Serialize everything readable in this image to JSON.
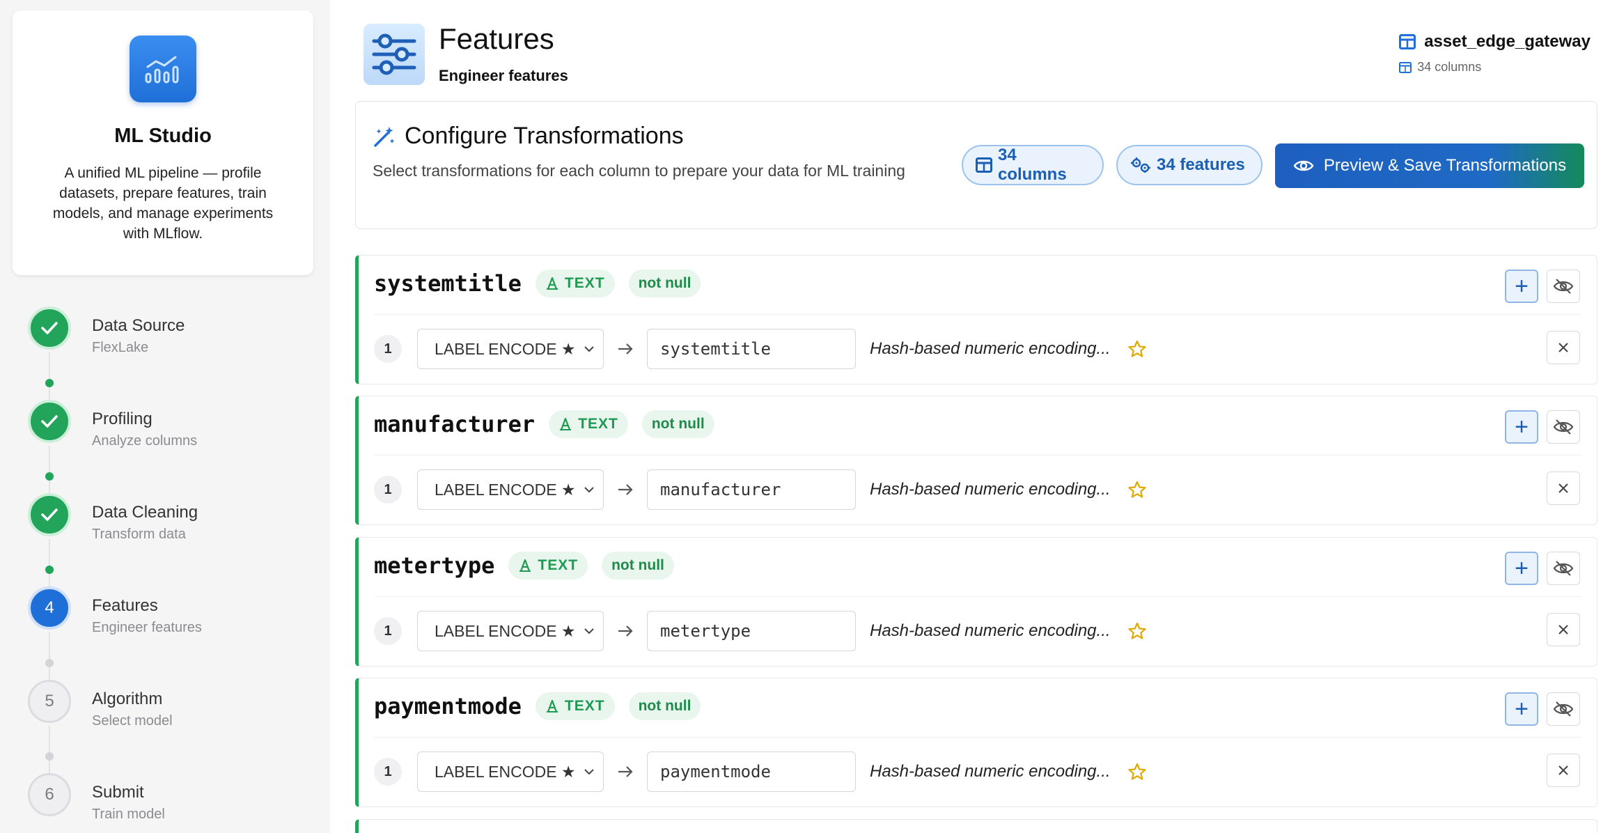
{
  "sidebar": {
    "brand": {
      "title": "ML Studio",
      "description": "A unified ML pipeline — profile datasets, prepare features, train models, and manage experiments with MLflow."
    },
    "steps": [
      {
        "number": "1",
        "title": "Data Source",
        "subtitle": "FlexLake",
        "status": "done"
      },
      {
        "number": "2",
        "title": "Profiling",
        "subtitle": "Analyze columns",
        "status": "done"
      },
      {
        "number": "3",
        "title": "Data Cleaning",
        "subtitle": "Transform data",
        "status": "done"
      },
      {
        "number": "4",
        "title": "Features",
        "subtitle": "Engineer features",
        "status": "active"
      },
      {
        "number": "5",
        "title": "Algorithm",
        "subtitle": "Select model",
        "status": "pending"
      },
      {
        "number": "6",
        "title": "Submit",
        "subtitle": "Train model",
        "status": "pending"
      }
    ]
  },
  "header": {
    "title": "Features",
    "subtitle": "Engineer features",
    "dataset_name": "asset_edge_gateway",
    "dataset_columns": "34 columns"
  },
  "config": {
    "title": "Configure Transformations",
    "description": "Select transformations for each column to prepare your data for ML training",
    "columns_pill": "34 columns",
    "features_pill": "34 features",
    "preview_button": "Preview & Save Transformations"
  },
  "features": [
    {
      "name": "systemtitle",
      "type": "TEXT",
      "nullability": "not null",
      "index": "1",
      "encoding": "LABEL ENCODE ★",
      "output_name": "systemtitle",
      "description": "Hash-based numeric encoding..."
    },
    {
      "name": "manufacturer",
      "type": "TEXT",
      "nullability": "not null",
      "index": "1",
      "encoding": "LABEL ENCODE ★",
      "output_name": "manufacturer",
      "description": "Hash-based numeric encoding..."
    },
    {
      "name": "metertype",
      "type": "TEXT",
      "nullability": "not null",
      "index": "1",
      "encoding": "LABEL ENCODE ★",
      "output_name": "metertype",
      "description": "Hash-based numeric encoding..."
    },
    {
      "name": "paymentmode",
      "type": "TEXT",
      "nullability": "not null",
      "index": "1",
      "encoding": "LABEL ENCODE ★",
      "output_name": "paymentmode",
      "description": "Hash-based numeric encoding..."
    }
  ],
  "colors": {
    "accent_blue": "#1f6fd8",
    "success_green": "#22a55a",
    "star_gold": "#e0a800"
  },
  "icons": {
    "brand": "chart-icon",
    "page": "sliders-icon",
    "dataset": "table-icon",
    "config": "magic-wand-icon",
    "type": "text-type-icon",
    "add": "plus-icon",
    "hide": "eye-off-icon",
    "remove": "close-icon",
    "arrow": "arrow-right-icon",
    "star": "star-icon",
    "preview": "eye-icon"
  }
}
